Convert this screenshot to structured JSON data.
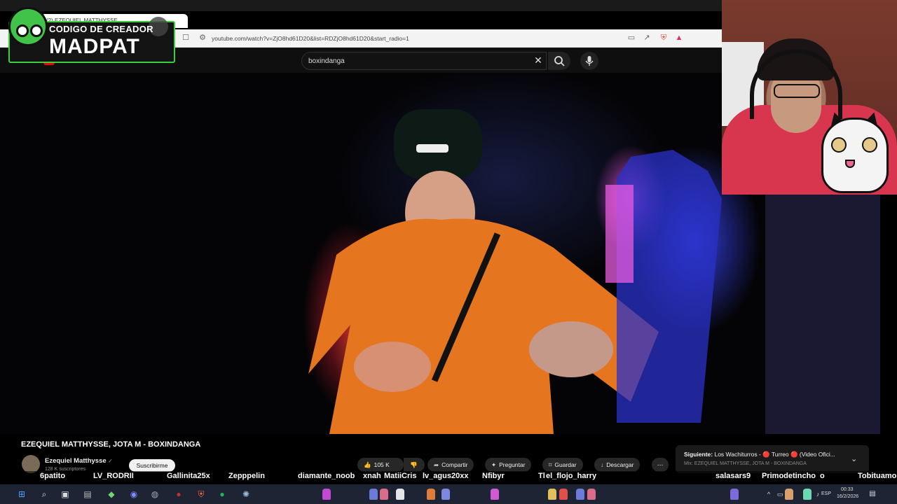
{
  "browser": {
    "tab_title": "(2) EZEQUIEL MATTHYSSE...",
    "url": "youtube.com/watch?v=ZjO8hd61D20&list=RDZjO8hd61D20&start_radio=1"
  },
  "youtube": {
    "logo_text": "YouTube",
    "search_value": "boxindanga"
  },
  "video": {
    "title": "EZEQUIEL MATTHYSSE, JOTA M - BOXINDANGA",
    "channel_name": "Ezequiel Matthysse",
    "verified_mark": "✓",
    "subscribers": "128 K suscriptores",
    "subscribe_label": "Suscribirme",
    "like_count": "105 K",
    "share_label": "Compartir",
    "ask_label": "Preguntar",
    "save_label": "Guardar",
    "download_label": "Descargar",
    "more_label": "⋯"
  },
  "up_next": {
    "prefix": "Siguiente:",
    "title": "Los Wachiturros - 🔴 Turreo 🔴 (Video Ofici...",
    "subtitle": "Mix: EZEQUIEL MATTHYSSE, JOTA M - BOXINDANGA"
  },
  "creator_badge": {
    "line1": "CODIGO DE CREADOR",
    "line2": "MADPAT"
  },
  "chat_ticker": [
    "6patito",
    "LV_RODRII",
    "Gallinita25x",
    "Zepppelin",
    "diamante_noob",
    "xnah",
    "MatiiCris",
    "lv_agus20xx",
    "Nfibyr",
    "Tl",
    "el_flojo_harry",
    "salasars9",
    "Primodetincho",
    "o",
    "Tobituamo"
  ],
  "taskbar": {
    "language": "ESP",
    "time": "00:33",
    "date": "16/2/2026"
  },
  "colors": {
    "badge_border": "#3cd03c",
    "yt_bg": "#0f0f0f",
    "taskbar_bg": "#1e2433",
    "accent_red": "#e00000"
  }
}
